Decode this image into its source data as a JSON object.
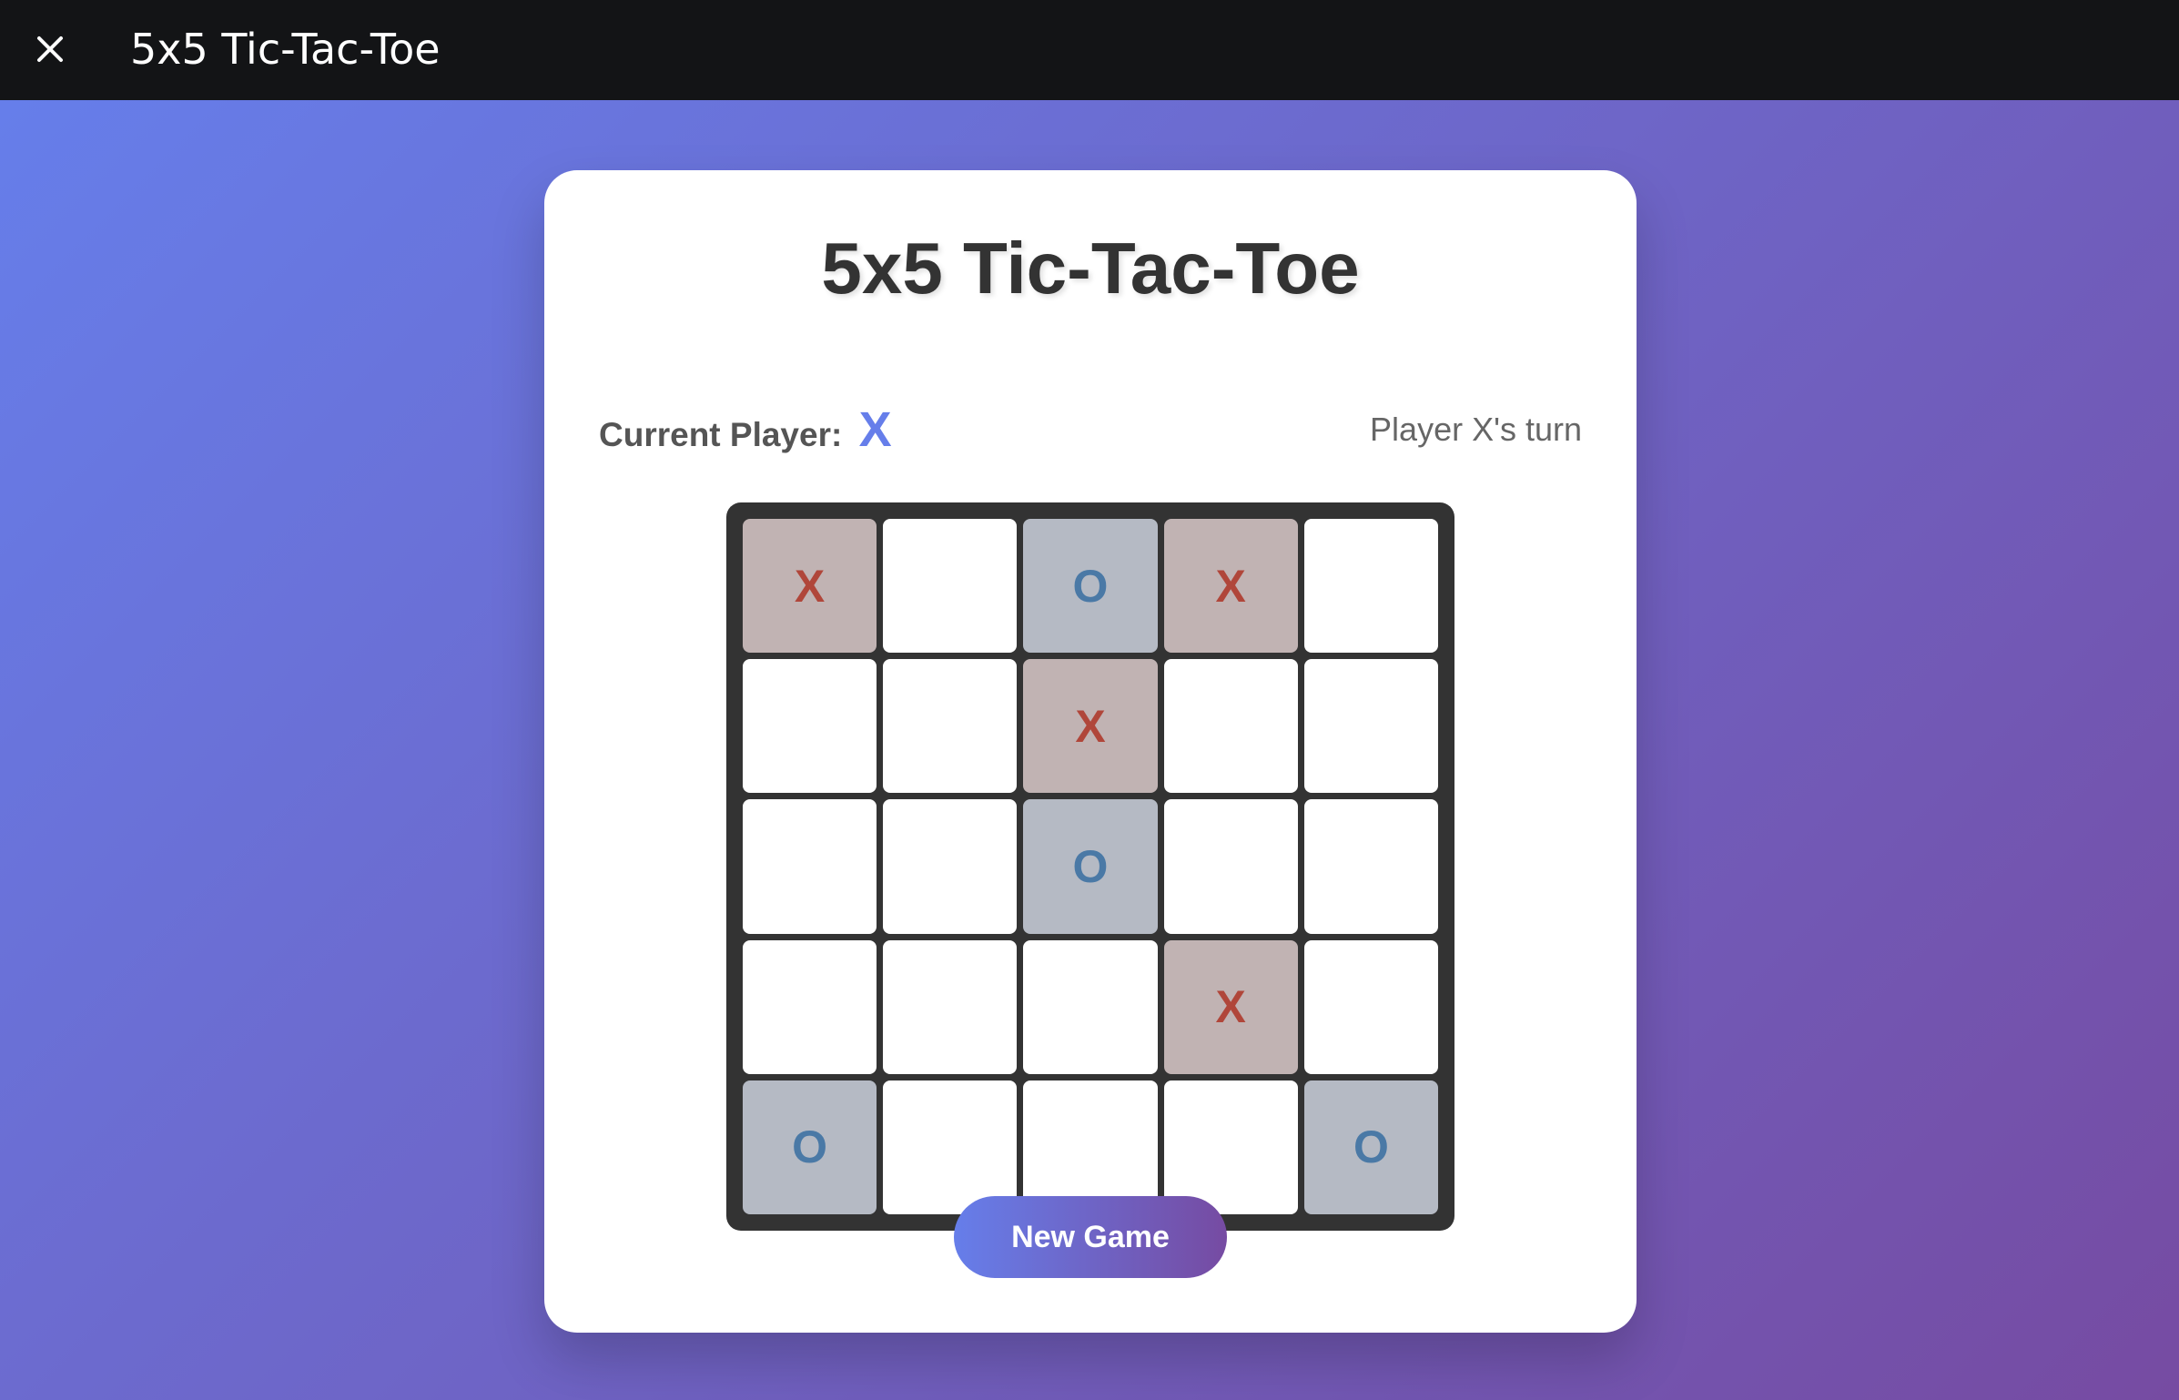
{
  "window": {
    "title": "5x5 Tic-Tac-Toe",
    "close_icon": "close-icon"
  },
  "game": {
    "title": "5x5 Tic-Tac-Toe",
    "current_player_label": "Current Player:",
    "current_player": "X",
    "status": "Player X's turn",
    "new_game_label": "New Game",
    "board": [
      [
        "X",
        "",
        "O",
        "X",
        ""
      ],
      [
        "",
        "",
        "X",
        "",
        ""
      ],
      [
        "",
        "",
        "O",
        "",
        ""
      ],
      [
        "",
        "",
        "",
        "X",
        ""
      ],
      [
        "O",
        "",
        "",
        "",
        "O"
      ]
    ]
  },
  "colors": {
    "accent_start": "#667eea",
    "accent_end": "#764ba2",
    "x_color": "#b0463a",
    "o_color": "#4a79a6",
    "board_bg": "#333333"
  }
}
